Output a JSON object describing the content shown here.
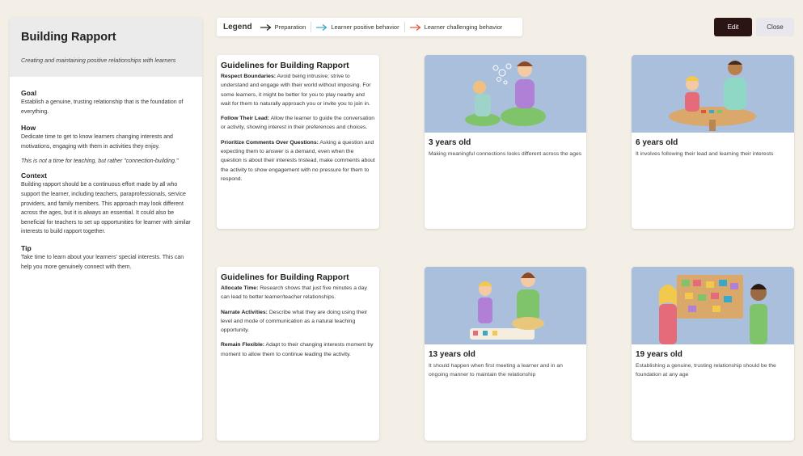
{
  "sidebar": {
    "title": "Building Rapport",
    "subtitle": "Creating and maintaining positive relationships with learners",
    "goal_heading": "Goal",
    "goal_text": "Establish a genuine, trusting relationship that is the foundation of everything.",
    "how_heading": "How",
    "how_text": "Dedicate time to get to know learners changing interests and motivations, engaging with them in activities they enjoy.",
    "note": "This is not a time for teaching, but rather \"connection-building.\"",
    "context_heading": "Context",
    "context_text": "Building rapport should be a continuous effort made by all who support the learner, including teachers, paraprofessionals, service providers, and family members. This approach may look different across the ages, but it is always an essential. It could also be beneficial for teachers to set up opportunities for learner with similar interests to build rapport together.",
    "tip_heading": "Tip",
    "tip_text": "Take time to learn about your learners' special interests. This can help you more genuinely connect with them."
  },
  "legend": {
    "title": "Legend",
    "items": [
      {
        "label": "Preparation",
        "color": "#222222"
      },
      {
        "label": "Learner positive behavior",
        "color": "#3aa6c8"
      },
      {
        "label": "Learner challenging behavior",
        "color": "#e2543a"
      }
    ]
  },
  "buttons": {
    "edit": "Edit",
    "close": "Close"
  },
  "guides": [
    {
      "title": "Guidelines for Building Rapport",
      "items": [
        {
          "label": "Respect Boundaries:",
          "text": "Avoid being intrusive; strive to understand and engage with their world without imposing. For some learners, it might be better for you to play nearby and wait for them to naturally approach you or invite you to join in."
        },
        {
          "label": "Follow Their Lead:",
          "text": "Allow the learner to guide the conversation or activity, showing interest in their preferences and choices."
        },
        {
          "label": "Prioritize Comments Over Questions:",
          "text": "Asking a question and expecting them to answer is a demand, even when the question is about their interests Instead, make comments about the activity to show engagement with no pressure for them to respond."
        }
      ]
    },
    {
      "title": "Guidelines for Building Rapport",
      "items": [
        {
          "label": "Allocate Time:",
          "text": "Research shows that just five minutes a day can lead to better learner/teacher relationships."
        },
        {
          "label": "Narrate Activities:",
          "text": "Describe what they are doing using their level and mode of communication as a natural teaching opportunity."
        },
        {
          "label": "Remain Flexible:",
          "text": "Adapt to their changing interests moment by moment to allow them to continue leading the activity."
        }
      ]
    }
  ],
  "ages": [
    {
      "title": "3 years old",
      "desc": "Making meaningful connections looks different across the ages",
      "icon": "bubbles-illustration"
    },
    {
      "title": "6 years old",
      "desc": "It involves following their lead and learning their interests",
      "icon": "table-play-illustration"
    },
    {
      "title": "13 years old",
      "desc": "It should happen when first meeting a learner and in an ongoing manner to maintain the relationship",
      "icon": "reading-illustration"
    },
    {
      "title": "19 years old",
      "desc": "Establishing a genuine, trusting relationship should be the foundation at any age",
      "icon": "board-illustration"
    }
  ],
  "colors": {
    "background": "#f3efe7",
    "illustration_bg": "#a9bfdc",
    "edit_button": "#2b1414"
  }
}
